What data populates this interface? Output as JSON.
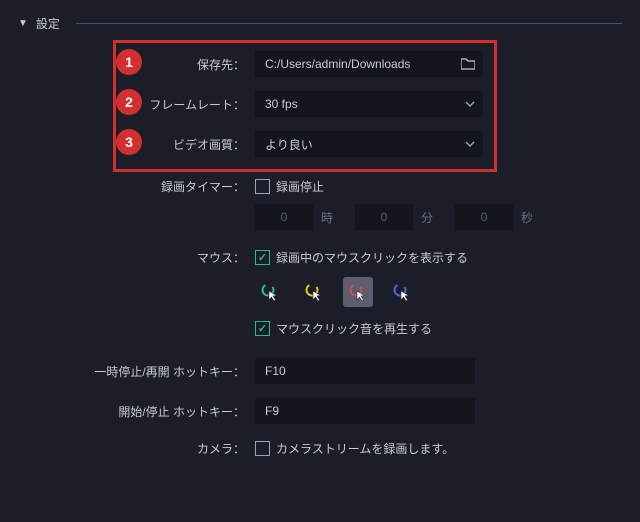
{
  "header": {
    "title": "設定"
  },
  "settings": {
    "save_path": {
      "label": "保存先：",
      "value": "C:/Users/admin/Downloads"
    },
    "framerate": {
      "label": "フレームレート：",
      "value": "30 fps"
    },
    "quality": {
      "label": "ビデオ画質：",
      "value": "より良い"
    },
    "rec_timer": {
      "label": "録画タイマー：",
      "stop_label": "録画停止",
      "stop_checked": false,
      "hours": "0",
      "hours_unit": "時",
      "minutes": "0",
      "minutes_unit": "分",
      "seconds": "0",
      "seconds_unit": "秒"
    },
    "mouse": {
      "label": "マウス：",
      "show_label": "録画中のマウスクリックを表示する",
      "show_checked": true,
      "sound_label": "マウスクリック音を再生する",
      "sound_checked": true,
      "options": [
        {
          "name": "green",
          "ring": "#2db88a",
          "selected": false
        },
        {
          "name": "yellow",
          "ring": "#e5c027",
          "selected": false
        },
        {
          "name": "red",
          "ring": "#d34b50",
          "selected": true
        },
        {
          "name": "blue",
          "ring": "#4a63d8",
          "selected": false
        }
      ]
    },
    "hotkeys": {
      "pause": {
        "label": "一時停止/再開 ホットキー：",
        "value": "F10"
      },
      "start": {
        "label": "開始/停止 ホットキー：",
        "value": "F9"
      }
    },
    "camera": {
      "label": "カメラ：",
      "stream_label": "カメラストリームを録画します。",
      "stream_checked": false
    }
  },
  "callouts": {
    "c1": "1",
    "c2": "2",
    "c3": "3"
  }
}
